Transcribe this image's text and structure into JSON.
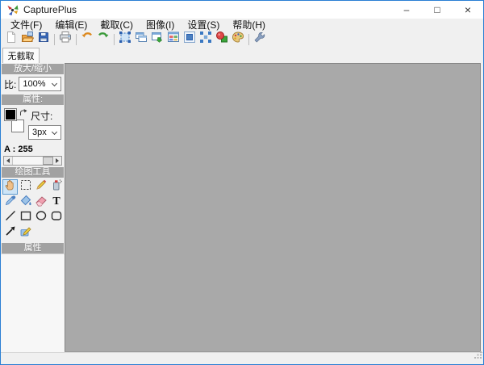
{
  "window": {
    "title": "CapturePlus"
  },
  "titlebar": {
    "minimize_glyph": "–",
    "maximize_glyph": "□",
    "close_glyph": "×"
  },
  "menubar": {
    "items": [
      {
        "label": "文件(F)"
      },
      {
        "label": "编辑(E)"
      },
      {
        "label": "截取(C)"
      },
      {
        "label": "图像(I)"
      },
      {
        "label": "设置(S)"
      },
      {
        "label": "帮助(H)"
      }
    ]
  },
  "toolbar": {
    "buttons": [
      "new-file-icon",
      "open-folder-icon",
      "save-icon",
      "print-icon",
      "undo-icon",
      "redo-icon",
      "capture-region-icon",
      "capture-window-icon",
      "capture-scroll-window-icon",
      "capture-element-icon",
      "capture-fixed-region-icon",
      "capture-freehand-icon",
      "shapes-icon",
      "palette-icon",
      "settings-wrench-icon"
    ]
  },
  "tab": {
    "label": "无截取"
  },
  "sidebar": {
    "zoom": {
      "header": "放大/缩小",
      "ratio_label": "比:",
      "value": "100%"
    },
    "properties": {
      "header": "属性:",
      "size_label": "尺寸:",
      "size_value": "3px",
      "alpha_label": "A :",
      "alpha_value": "255",
      "foreground_color": "#000000",
      "background_color": "#ffffff"
    },
    "tools": {
      "header": "绘图工具",
      "selected": "hand",
      "items": [
        "hand",
        "marquee-select",
        "pencil",
        "spray",
        "eyedropper",
        "fill-bucket",
        "eraser",
        "text",
        "line",
        "rectangle",
        "ellipse",
        "rounded-rectangle",
        "arrow",
        "highlighter"
      ]
    },
    "properties2": {
      "header": "属性"
    }
  },
  "colors": {
    "window_border": "#2a7fd4",
    "section_header_bg": "#a2a2a2",
    "canvas_bg": "#a9a9a9",
    "chrome_bg": "#f0f0f0",
    "selected_tool_bg": "#cde4f6"
  }
}
